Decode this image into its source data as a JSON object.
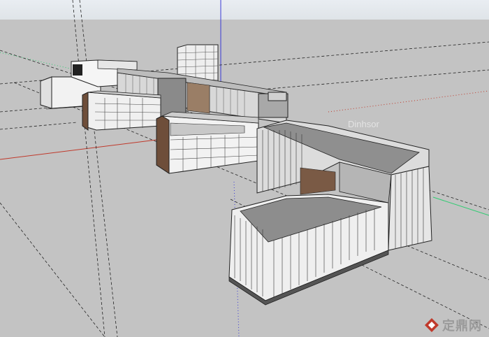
{
  "viewport": {
    "sky_color": "#e5e9ed",
    "ground_color": "#c3c3c3",
    "axis_red": "#c0392b",
    "axis_green": "#2ecc71",
    "axis_blue": "#3a3ad6"
  },
  "watermark": {
    "logo": "diamond-logo-icon",
    "text": "定鼎网",
    "inline_text": "Dinhsor"
  }
}
